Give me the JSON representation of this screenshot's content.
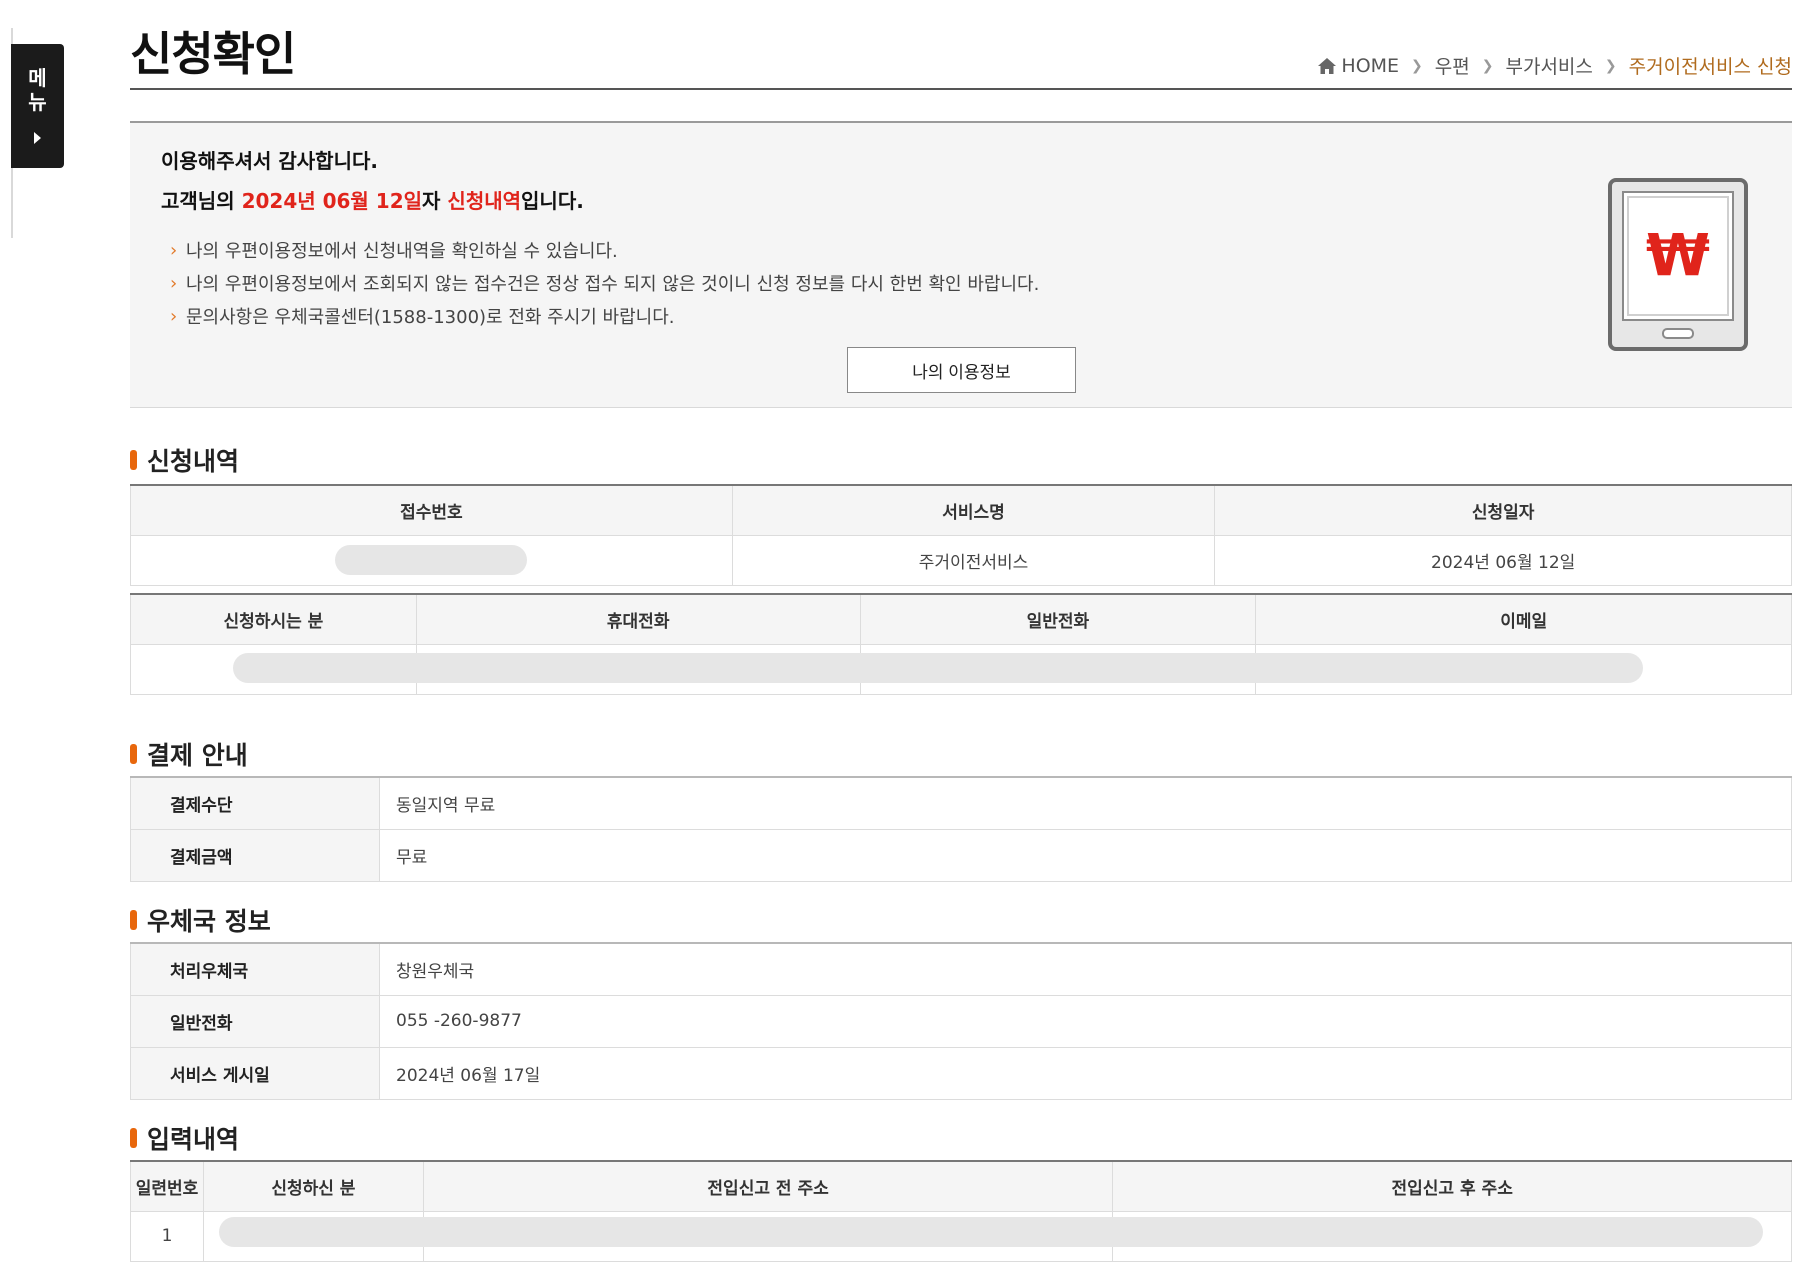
{
  "side_menu": {
    "label_line1": "메",
    "label_line2": "뉴"
  },
  "header": {
    "title": "신청확인",
    "breadcrumb": [
      "HOME",
      "우편",
      "부가서비스",
      "주거이전서비스 신청"
    ]
  },
  "confirm": {
    "thanks": "이용해주셔서 감사합니다.",
    "summary_prefix": "고객님의 ",
    "summary_date": "2024년 06월 12일",
    "summary_mid": "자 ",
    "summary_highlight": "신청내역",
    "summary_suffix": "입니다.",
    "notes": [
      "나의 우편이용정보에서 신청내역을 확인하실 수 있습니다.",
      "나의 우편이용정보에서 조회되지 않는 접수건은 정상 접수 되지 않은 것이니 신청 정보를 다시 한번 확인 바랍니다.",
      "문의사항은 우체국콜센터(1588-1300)로 전화 주시기 바랍니다."
    ],
    "button_label": "나의 이용정보",
    "image_icon": "won-tablet-icon",
    "icon_symbol": "₩"
  },
  "sections": {
    "application": "신청내역",
    "payment": "결제 안내",
    "post_office": "우체국 정보",
    "input": "입력내역"
  },
  "application_table": {
    "headers": [
      "접수번호",
      "서비스명",
      "신청일자"
    ],
    "row": {
      "receipt_no": "",
      "service_name": "주거이전서비스",
      "date": "2024년 06월 12일"
    }
  },
  "applicant_table": {
    "headers": [
      "신청하시는 분",
      "휴대전화",
      "일반전화",
      "이메일"
    ]
  },
  "payment": {
    "rows": [
      {
        "label": "결제수단",
        "value": "동일지역 무료"
      },
      {
        "label": "결제금액",
        "value": "무료"
      }
    ]
  },
  "post_office": {
    "rows": [
      {
        "label": "처리우체국",
        "value": "창원우체국"
      },
      {
        "label": "일반전화",
        "value": "055 -260-9877"
      },
      {
        "label": "서비스 게시일",
        "value": "2024년 06월 17일"
      }
    ]
  },
  "input_table": {
    "headers": [
      "일련번호",
      "신청하신 분",
      "전입신고 전 주소",
      "전입신고 후 주소"
    ],
    "row": {
      "serial": "1"
    }
  },
  "colors": {
    "accent": "#e8670c",
    "highlight_red": "#e0241b",
    "breadcrumb_current": "#b06b1e"
  }
}
